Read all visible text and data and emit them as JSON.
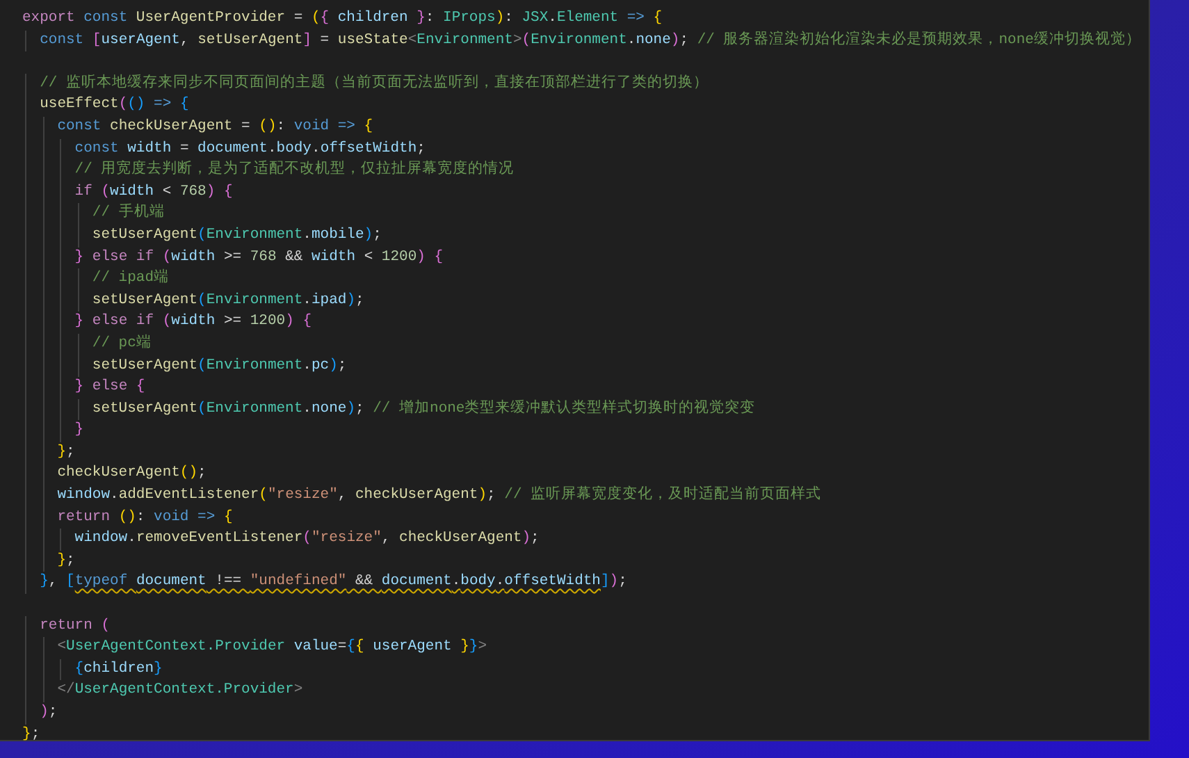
{
  "editor": {
    "lines": [
      {
        "kind": "code",
        "tokens": [
          {
            "text": "export ",
            "kind": "ctl"
          },
          {
            "text": "const ",
            "kind": "kw"
          },
          {
            "text": "UserAgentProvider",
            "kind": "fn"
          },
          {
            "text": " = ",
            "kind": "p"
          },
          {
            "text": "(",
            "kind": "b1"
          },
          {
            "text": "{",
            "kind": "b2"
          },
          {
            "text": " children ",
            "kind": "var"
          },
          {
            "text": "}",
            "kind": "b2"
          },
          {
            "text": ": ",
            "kind": "p"
          },
          {
            "text": "IProps",
            "kind": "type"
          },
          {
            "text": ")",
            "kind": "b1"
          },
          {
            "text": ": ",
            "kind": "p"
          },
          {
            "text": "JSX",
            "kind": "type"
          },
          {
            "text": ".",
            "kind": "p"
          },
          {
            "text": "Element",
            "kind": "type"
          },
          {
            "text": " => ",
            "kind": "kw"
          },
          {
            "text": "{",
            "kind": "b1"
          }
        ]
      },
      {
        "kind": "code",
        "tokens": [
          {
            "text": "  const ",
            "kind": "kw"
          },
          {
            "text": "[",
            "kind": "b2"
          },
          {
            "text": "userAgent",
            "kind": "var"
          },
          {
            "text": ", ",
            "kind": "p"
          },
          {
            "text": "setUserAgent",
            "kind": "fn"
          },
          {
            "text": "]",
            "kind": "b2"
          },
          {
            "text": " = ",
            "kind": "p"
          },
          {
            "text": "useState",
            "kind": "fn"
          },
          {
            "text": "<",
            "kind": "tag"
          },
          {
            "text": "Environment",
            "kind": "type"
          },
          {
            "text": ">",
            "kind": "tag"
          },
          {
            "text": "(",
            "kind": "b2"
          },
          {
            "text": "Environment",
            "kind": "type"
          },
          {
            "text": ".",
            "kind": "p"
          },
          {
            "text": "none",
            "kind": "var"
          },
          {
            "text": ")",
            "kind": "b2"
          },
          {
            "text": "; ",
            "kind": "p"
          },
          {
            "text": "// 服务器渲染初始化渲染未必是预期效果，none缓冲切换视觉）",
            "kind": "cmt"
          }
        ]
      },
      {
        "kind": "blank"
      },
      {
        "kind": "code",
        "tokens": [
          {
            "text": "  // 监听本地缓存来同步不同页面间的主题（当前页面无法监听到，直接在顶部栏进行了类的切换）",
            "kind": "cmt"
          }
        ]
      },
      {
        "kind": "code",
        "tokens": [
          {
            "text": "  useEffect",
            "kind": "fn"
          },
          {
            "text": "(",
            "kind": "b2"
          },
          {
            "text": "()",
            "kind": "b3"
          },
          {
            "text": " => ",
            "kind": "kw"
          },
          {
            "text": "{",
            "kind": "b3"
          }
        ]
      },
      {
        "kind": "code",
        "tokens": [
          {
            "text": "    const ",
            "kind": "kw"
          },
          {
            "text": "checkUserAgent",
            "kind": "fn"
          },
          {
            "text": " = ",
            "kind": "p"
          },
          {
            "text": "()",
            "kind": "b1"
          },
          {
            "text": ": ",
            "kind": "p"
          },
          {
            "text": "void",
            "kind": "kw"
          },
          {
            "text": " => ",
            "kind": "kw"
          },
          {
            "text": "{",
            "kind": "b1"
          }
        ]
      },
      {
        "kind": "code",
        "tokens": [
          {
            "text": "      const ",
            "kind": "kw"
          },
          {
            "text": "width",
            "kind": "var"
          },
          {
            "text": " = ",
            "kind": "p"
          },
          {
            "text": "document",
            "kind": "var"
          },
          {
            "text": ".",
            "kind": "p"
          },
          {
            "text": "body",
            "kind": "var"
          },
          {
            "text": ".",
            "kind": "p"
          },
          {
            "text": "offsetWidth",
            "kind": "var"
          },
          {
            "text": ";",
            "kind": "p"
          }
        ]
      },
      {
        "kind": "code",
        "tokens": [
          {
            "text": "      // 用宽度去判断，是为了适配不改机型，仅拉扯屏幕宽度的情况",
            "kind": "cmt"
          }
        ]
      },
      {
        "kind": "code",
        "tokens": [
          {
            "text": "      if ",
            "kind": "ctl"
          },
          {
            "text": "(",
            "kind": "b2"
          },
          {
            "text": "width",
            "kind": "var"
          },
          {
            "text": " < ",
            "kind": "p"
          },
          {
            "text": "768",
            "kind": "num"
          },
          {
            "text": ")",
            "kind": "b2"
          },
          {
            "text": " {",
            "kind": "b2"
          }
        ]
      },
      {
        "kind": "code",
        "tokens": [
          {
            "text": "        // 手机端",
            "kind": "cmt"
          }
        ]
      },
      {
        "kind": "code",
        "tokens": [
          {
            "text": "        setUserAgent",
            "kind": "fn"
          },
          {
            "text": "(",
            "kind": "b3"
          },
          {
            "text": "Environment",
            "kind": "type"
          },
          {
            "text": ".",
            "kind": "p"
          },
          {
            "text": "mobile",
            "kind": "var"
          },
          {
            "text": ")",
            "kind": "b3"
          },
          {
            "text": ";",
            "kind": "p"
          }
        ]
      },
      {
        "kind": "code",
        "tokens": [
          {
            "text": "      }",
            "kind": "b2"
          },
          {
            "text": " else if ",
            "kind": "ctl"
          },
          {
            "text": "(",
            "kind": "b2"
          },
          {
            "text": "width",
            "kind": "var"
          },
          {
            "text": " >= ",
            "kind": "p"
          },
          {
            "text": "768",
            "kind": "num"
          },
          {
            "text": " && ",
            "kind": "p"
          },
          {
            "text": "width",
            "kind": "var"
          },
          {
            "text": " < ",
            "kind": "p"
          },
          {
            "text": "1200",
            "kind": "num"
          },
          {
            "text": ")",
            "kind": "b2"
          },
          {
            "text": " {",
            "kind": "b2"
          }
        ]
      },
      {
        "kind": "code",
        "tokens": [
          {
            "text": "        // ipad端",
            "kind": "cmt"
          }
        ]
      },
      {
        "kind": "code",
        "tokens": [
          {
            "text": "        setUserAgent",
            "kind": "fn"
          },
          {
            "text": "(",
            "kind": "b3"
          },
          {
            "text": "Environment",
            "kind": "type"
          },
          {
            "text": ".",
            "kind": "p"
          },
          {
            "text": "ipad",
            "kind": "var"
          },
          {
            "text": ")",
            "kind": "b3"
          },
          {
            "text": ";",
            "kind": "p"
          }
        ]
      },
      {
        "kind": "code",
        "tokens": [
          {
            "text": "      }",
            "kind": "b2"
          },
          {
            "text": " else if ",
            "kind": "ctl"
          },
          {
            "text": "(",
            "kind": "b2"
          },
          {
            "text": "width",
            "kind": "var"
          },
          {
            "text": " >= ",
            "kind": "p"
          },
          {
            "text": "1200",
            "kind": "num"
          },
          {
            "text": ")",
            "kind": "b2"
          },
          {
            "text": " {",
            "kind": "b2"
          }
        ]
      },
      {
        "kind": "code",
        "tokens": [
          {
            "text": "        // pc端",
            "kind": "cmt"
          }
        ]
      },
      {
        "kind": "code",
        "tokens": [
          {
            "text": "        setUserAgent",
            "kind": "fn"
          },
          {
            "text": "(",
            "kind": "b3"
          },
          {
            "text": "Environment",
            "kind": "type"
          },
          {
            "text": ".",
            "kind": "p"
          },
          {
            "text": "pc",
            "kind": "var"
          },
          {
            "text": ")",
            "kind": "b3"
          },
          {
            "text": ";",
            "kind": "p"
          }
        ]
      },
      {
        "kind": "code",
        "tokens": [
          {
            "text": "      }",
            "kind": "b2"
          },
          {
            "text": " else ",
            "kind": "ctl"
          },
          {
            "text": "{",
            "kind": "b2"
          }
        ]
      },
      {
        "kind": "code",
        "tokens": [
          {
            "text": "        setUserAgent",
            "kind": "fn"
          },
          {
            "text": "(",
            "kind": "b3"
          },
          {
            "text": "Environment",
            "kind": "type"
          },
          {
            "text": ".",
            "kind": "p"
          },
          {
            "text": "none",
            "kind": "var"
          },
          {
            "text": ")",
            "kind": "b3"
          },
          {
            "text": "; ",
            "kind": "p"
          },
          {
            "text": "// 增加none类型来缓冲默认类型样式切换时的视觉突变",
            "kind": "cmt"
          }
        ]
      },
      {
        "kind": "code",
        "tokens": [
          {
            "text": "      }",
            "kind": "b2"
          }
        ]
      },
      {
        "kind": "code",
        "tokens": [
          {
            "text": "    }",
            "kind": "b1"
          },
          {
            "text": ";",
            "kind": "p"
          }
        ]
      },
      {
        "kind": "code",
        "tokens": [
          {
            "text": "    checkUserAgent",
            "kind": "fn"
          },
          {
            "text": "()",
            "kind": "b1"
          },
          {
            "text": ";",
            "kind": "p"
          }
        ]
      },
      {
        "kind": "code",
        "tokens": [
          {
            "text": "    window",
            "kind": "var"
          },
          {
            "text": ".",
            "kind": "p"
          },
          {
            "text": "addEventListener",
            "kind": "fn"
          },
          {
            "text": "(",
            "kind": "b1"
          },
          {
            "text": "\"resize\"",
            "kind": "str"
          },
          {
            "text": ", ",
            "kind": "p"
          },
          {
            "text": "checkUserAgent",
            "kind": "fn"
          },
          {
            "text": ")",
            "kind": "b1"
          },
          {
            "text": "; ",
            "kind": "p"
          },
          {
            "text": "// 监听屏幕宽度变化，及时适配当前页面样式",
            "kind": "cmt"
          }
        ]
      },
      {
        "kind": "code",
        "tokens": [
          {
            "text": "    return ",
            "kind": "ctl"
          },
          {
            "text": "()",
            "kind": "b1"
          },
          {
            "text": ": ",
            "kind": "p"
          },
          {
            "text": "void",
            "kind": "kw"
          },
          {
            "text": " => ",
            "kind": "kw"
          },
          {
            "text": "{",
            "kind": "b1"
          }
        ]
      },
      {
        "kind": "code",
        "tokens": [
          {
            "text": "      window",
            "kind": "var"
          },
          {
            "text": ".",
            "kind": "p"
          },
          {
            "text": "removeEventListener",
            "kind": "fn"
          },
          {
            "text": "(",
            "kind": "b2"
          },
          {
            "text": "\"resize\"",
            "kind": "str"
          },
          {
            "text": ", ",
            "kind": "p"
          },
          {
            "text": "checkUserAgent",
            "kind": "fn"
          },
          {
            "text": ")",
            "kind": "b2"
          },
          {
            "text": ";",
            "kind": "p"
          }
        ]
      },
      {
        "kind": "code",
        "tokens": [
          {
            "text": "    }",
            "kind": "b1"
          },
          {
            "text": ";",
            "kind": "p"
          }
        ]
      },
      {
        "kind": "code",
        "tokens": [
          {
            "text": "  }",
            "kind": "b3"
          },
          {
            "text": ", ",
            "kind": "p"
          },
          {
            "text": "[",
            "kind": "b3"
          },
          {
            "kind": "warning",
            "tokens": [
              {
                "text": "typeof ",
                "kind": "kw"
              },
              {
                "text": "document",
                "kind": "var"
              },
              {
                "text": " !== ",
                "kind": "p"
              },
              {
                "text": "\"undefined\"",
                "kind": "str"
              },
              {
                "text": " && ",
                "kind": "p"
              },
              {
                "text": "document",
                "kind": "var"
              },
              {
                "text": ".",
                "kind": "p"
              },
              {
                "text": "body",
                "kind": "var"
              },
              {
                "text": ".",
                "kind": "p"
              },
              {
                "text": "offsetWidth",
                "kind": "var"
              }
            ]
          },
          {
            "text": "]",
            "kind": "b3"
          },
          {
            "text": ")",
            "kind": "b2"
          },
          {
            "text": ";",
            "kind": "p"
          }
        ]
      },
      {
        "kind": "blank"
      },
      {
        "kind": "code",
        "tokens": [
          {
            "text": "  return ",
            "kind": "ctl"
          },
          {
            "text": "(",
            "kind": "b2"
          }
        ]
      },
      {
        "kind": "code",
        "tokens": [
          {
            "text": "    <",
            "kind": "tag"
          },
          {
            "text": "UserAgentContext.Provider",
            "kind": "type"
          },
          {
            "text": " value",
            "kind": "var"
          },
          {
            "text": "=",
            "kind": "p"
          },
          {
            "text": "{",
            "kind": "b3"
          },
          {
            "text": "{",
            "kind": "b1"
          },
          {
            "text": " userAgent ",
            "kind": "var"
          },
          {
            "text": "}",
            "kind": "b1"
          },
          {
            "text": "}",
            "kind": "b3"
          },
          {
            "text": ">",
            "kind": "tag"
          }
        ]
      },
      {
        "kind": "code",
        "tokens": [
          {
            "text": "      {",
            "kind": "b3"
          },
          {
            "text": "children",
            "kind": "var"
          },
          {
            "text": "}",
            "kind": "b3"
          }
        ]
      },
      {
        "kind": "code",
        "tokens": [
          {
            "text": "    </",
            "kind": "tag"
          },
          {
            "text": "UserAgentContext.Provider",
            "kind": "type"
          },
          {
            "text": ">",
            "kind": "tag"
          }
        ]
      },
      {
        "kind": "code",
        "tokens": [
          {
            "text": "  )",
            "kind": "b2"
          },
          {
            "text": ";",
            "kind": "p"
          }
        ]
      },
      {
        "kind": "code",
        "tokens": [
          {
            "text": "}",
            "kind": "b1"
          },
          {
            "text": ";",
            "kind": "p"
          }
        ]
      }
    ]
  }
}
